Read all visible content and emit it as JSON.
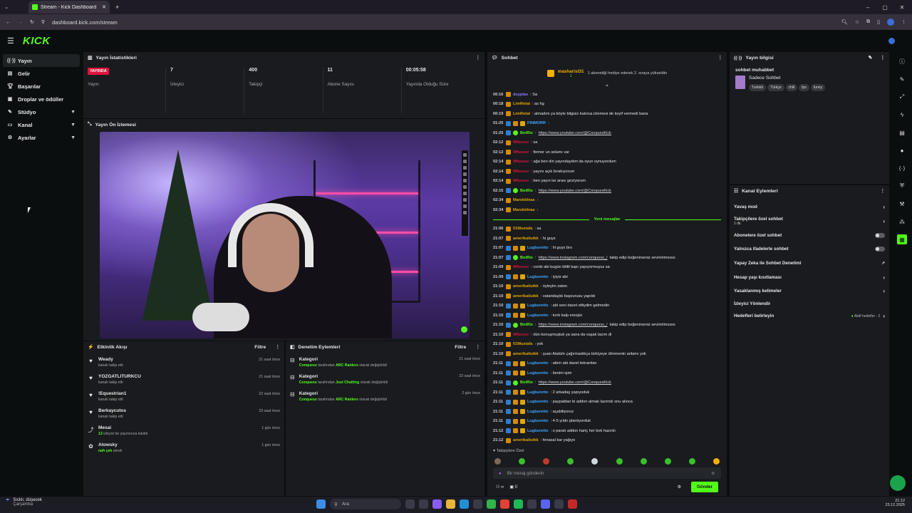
{
  "browser": {
    "tab_title": "Stream - Kick Dashboard",
    "url": "dashboard.kick.com/stream"
  },
  "header": {
    "logo": "KICK"
  },
  "sidebar": {
    "items": [
      {
        "label": "Yayın",
        "icon": "broadcast-icon"
      },
      {
        "label": "Gelir",
        "icon": "revenue-icon"
      },
      {
        "label": "Başarılar",
        "icon": "trophy-icon"
      },
      {
        "label": "Droplar ve ödüller",
        "icon": "gift-icon"
      },
      {
        "label": "Stüdyo",
        "icon": "studio-icon"
      },
      {
        "label": "Kanal",
        "icon": "channel-icon"
      },
      {
        "label": "Ayarlar",
        "icon": "gear-icon"
      }
    ]
  },
  "stats": {
    "title": "Yayın İstatistikleri",
    "live_badge": "YAYINDA",
    "items": [
      {
        "value": "",
        "label": "Yayın"
      },
      {
        "value": "7",
        "label": "İzleyici"
      },
      {
        "value": "400",
        "label": "Takipçi"
      },
      {
        "value": "11",
        "label": "Abone Sayısı"
      },
      {
        "value": "00:05:58",
        "label": "Yayında Olduğu Süre"
      }
    ]
  },
  "preview": {
    "title": "Yayın Ön İzlemesi"
  },
  "activity": {
    "title": "Etkinlik Akışı",
    "filter": "Filtre",
    "events": [
      {
        "name": "Weady",
        "sub": "kanalı takip etti",
        "time": "21 saat önce"
      },
      {
        "name": "YOZGATLITURKCU",
        "sub": "kanalı takip etti",
        "time": "21 saat önce"
      },
      {
        "name": "!Equestrian1",
        "sub": "kanalı takip etti",
        "time": "22 saat önce"
      },
      {
        "name": "Berkaycutos",
        "sub": "kanalı takip etti",
        "time": "23 saat önce"
      },
      {
        "name": "Mesai",
        "sub_count": "13",
        "sub": "izleyici ile yayınınıza katıldı",
        "time": "1 gün önce"
      },
      {
        "name": "Atowsky",
        "sub_hl": "nah çek",
        "sub": "alındı",
        "time": "1 gün önce"
      }
    ]
  },
  "modlog": {
    "title": "Denetim Eylemleri",
    "filter": "Filtre",
    "events": [
      {
        "name": "Kategori",
        "actor": "Conquess",
        "mid": "tarafından",
        "value": "ARC Raiders",
        "end": "olarak değiştirildi",
        "time": "21 saat önce"
      },
      {
        "name": "Kategori",
        "actor": "Conquess",
        "mid": "tarafından",
        "value": "Just Chatting",
        "end": "olarak değiştirildi",
        "time": "23 saat önce"
      },
      {
        "name": "Kategori",
        "actor": "Conquess",
        "mid": "tarafından",
        "value": "ARC Raiders",
        "end": "olarak değiştirildi",
        "time": "2 gün önce"
      }
    ]
  },
  "chat": {
    "title": "Sohbet",
    "pinned_user": "masharist31",
    "pinned_sub": "1",
    "gift_text": "1 aboneliği hediye ederek 2. sıraya yükseldin",
    "messages_top": [
      {
        "ts": "00:16",
        "user": "duyplas",
        "color": "#8a7cff",
        "text": ": Sa"
      },
      {
        "ts": "00:18",
        "user": "LimRetat",
        "color": "#e0a500",
        "text": ": as hg"
      },
      {
        "ts": "00:19",
        "user": "LimRetat",
        "color": "#e0a500",
        "text": ": almadım ya böyle bilgisiz kalınca izlemesi de keyif vermedi bana"
      },
      {
        "ts": "01:25",
        "user": "FINMORR",
        "color": "#3ea6ff",
        "text": ":"
      },
      {
        "ts": "01:25",
        "user": "BotRix",
        "color": "#53fc18",
        "text": ":",
        "link": "https://www.youtube.com/@ConquesKick"
      },
      {
        "ts": "02:12",
        "user": "Wfsosor",
        "color": "#e0143c",
        "text": ": sa"
      },
      {
        "ts": "02:12",
        "user": "Wfsosor",
        "color": "#e0143c",
        "text": ": finmor un selamı var"
      },
      {
        "ts": "02:14",
        "user": "Wfsosor",
        "color": "#e0143c",
        "text": ": ağa ben din yayındaydım da oyun oynuyordum"
      },
      {
        "ts": "02:14",
        "user": "Wfsosor",
        "color": "#e0143c",
        "text": ": yayını açık bırakıyorum"
      },
      {
        "ts": "02:14",
        "user": "Wfsosor",
        "color": "#e0143c",
        "text": ": ben yayın lar arası geziyorum"
      },
      {
        "ts": "02:15",
        "user": "BotRix",
        "color": "#53fc18",
        "text": ":",
        "link": "https://www.youtube.com/@ConquesKick"
      },
      {
        "ts": "02:34",
        "user": "Mandolinas",
        "color": "#e0a500",
        "text": ":"
      },
      {
        "ts": "02:34",
        "user": "Mandolinas",
        "color": "#e0a500",
        "text": ":"
      }
    ],
    "new_messages_label": "Yeni mesajlar",
    "messages_bottom": [
      {
        "ts": "21:06",
        "user": "01Mustafa",
        "color": "#e0a500",
        "text": ": sa"
      },
      {
        "ts": "21:07",
        "user": "amerikaliutkk",
        "color": "#e0a500",
        "text": ": hi guys"
      },
      {
        "ts": "21:07",
        "user": "Lugburetto",
        "color": "#3ea6ff",
        "text": ": hi guys bro"
      },
      {
        "ts": "21:07",
        "user": "BotRix",
        "color": "#53fc18",
        "text": ":",
        "link": "https://www.instagram.com/conquess_/",
        "after": " takip edip beğenirseniz sevinirimssss"
      },
      {
        "ts": "21:09",
        "user": "Wfsosor",
        "color": "#e0143c",
        "text": ": conki abi bugün kilitli kapı yapıyormuyuz sa"
      },
      {
        "ts": "21:09",
        "user": "Lugburetto",
        "color": "#3ea6ff",
        "text": ": iyiyiz abi"
      },
      {
        "ts": "21:10",
        "user": "amerikaliutkk",
        "color": "#e0a500",
        "text": ": öyleyim zaten"
      },
      {
        "ts": "21:10",
        "user": "amerikaliutkk",
        "color": "#e0a500",
        "text": ": vatandaşlık başvurusu yapıldı"
      },
      {
        "ts": "21:10",
        "user": "Lugburetto",
        "color": "#3ea6ff",
        "text": ": abi seni davet ettiydim gelmedin"
      },
      {
        "ts": "21:10",
        "user": "Lugburetto",
        "color": "#3ea6ff",
        "text": ": kırık kalp emojisi"
      },
      {
        "ts": "21:10",
        "user": "BotRix",
        "color": "#53fc18",
        "text": ":",
        "link": "https://www.instagram.com/conquess_/",
        "after": " takip edip beğenirseniz sevinirimssss"
      },
      {
        "ts": "21:10",
        "user": "Wfsosor",
        "color": "#e0143c",
        "text": ": dün konuşmuştuk ya sana da vaşak lazım di"
      },
      {
        "ts": "21:10",
        "user": "01Mustafa",
        "color": "#e0a500",
        "text": ": yok"
      },
      {
        "ts": "21:10",
        "user": "amerikaliutkk",
        "color": "#e0a500",
        "text": ": şuan Atatürk çağırmadıkça türkiyeye dönmenin anlamı yok"
      },
      {
        "ts": "21:11",
        "user": "Lugburetto",
        "color": "#3ea6ff",
        "text": ": attım abi davet tekrardan"
      },
      {
        "ts": "21:11",
        "user": "Lugburetto",
        "color": "#3ea6ff",
        "text": ": benim işim"
      },
      {
        "ts": "21:11",
        "user": "BotRix",
        "color": "#53fc18",
        "text": ":",
        "link": "https://www.youtube.com/@ConquesKick"
      },
      {
        "ts": "21:11",
        "user": "Lugburetto",
        "color": "#3ea6ff",
        "text": ": 2 arkadaş yapıyoduk"
      },
      {
        "ts": "21:11",
        "user": "Lugburetto",
        "color": "#3ea6ff",
        "text": ": paypaldan bi addon almak lazımdı onu alınca"
      },
      {
        "ts": "21:11",
        "user": "Lugburetto",
        "color": "#3ea6ff",
        "text": ": açabiliyoruz"
      },
      {
        "ts": "21:11",
        "user": "Lugburetto",
        "color": "#3ea6ff",
        "text": ": 4-5 yıldır planlıyorduk"
      },
      {
        "ts": "21:12",
        "user": "Lugburetto",
        "color": "#3ea6ff",
        "text": ": o paralı addon hariç her bok hazırdı"
      },
      {
        "ts": "21:12",
        "user": "amerikaliutkk",
        "color": "#e0a500",
        "text": ": fenasal kar yağıyo"
      }
    ],
    "followers_only": "Takipçilere Özel",
    "input_placeholder": "Bir mesaj gönderin",
    "bottom_count": "0",
    "send_label": "Gönder"
  },
  "stream_info": {
    "title": "Yayın bilgisi",
    "stream_title": "sohbet muhabbet",
    "category": "Sadece Sohbet",
    "tags": [
      "Turkish",
      "Türkçe",
      "chill",
      "fps",
      "funny"
    ]
  },
  "channel_actions": {
    "title": "Kanal Eylemleri",
    "items": [
      {
        "label": "Yavaş mod",
        "type": "chevron"
      },
      {
        "label": "Takipçilere özel sohbet",
        "sub": "1 dk.",
        "type": "chevron"
      },
      {
        "label": "Abonelere özel sohbet",
        "type": "toggle"
      },
      {
        "label": "Yalnızca ifadelerle sohbet",
        "type": "toggle"
      },
      {
        "label": "Yapay Zeka ile Sohbet Denetimi",
        "type": "external"
      },
      {
        "label": "Hesap yaşı kısıtlaması",
        "type": "chevron"
      },
      {
        "label": "Yasaklanmış kelimeler",
        "type": "chevron"
      },
      {
        "label": "İzleyici Yönlendir",
        "type": "none"
      },
      {
        "label": "Hedefleri belirleyin",
        "status": "Aktif hedefler - 2",
        "type": "chevron"
      }
    ]
  },
  "taskbar": {
    "weather_line1": "Sıcklı, düşecek",
    "weather_line2": "Çarşamba",
    "search": "Ara",
    "time": "21:12",
    "date": "23.12.2025"
  }
}
